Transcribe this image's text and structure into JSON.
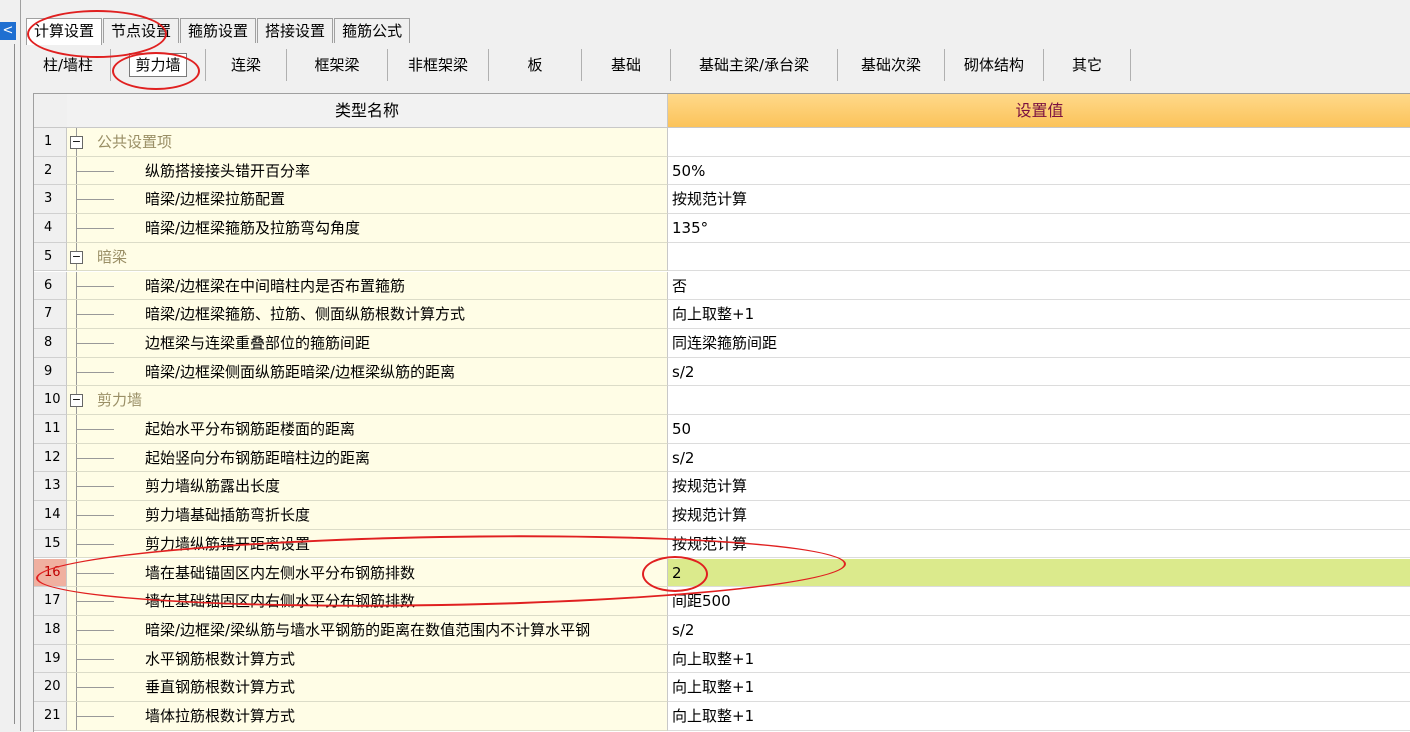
{
  "tabs_primary": [
    "计算设置",
    "节点设置",
    "箍筋设置",
    "搭接设置",
    "箍筋公式"
  ],
  "tabs_primary_active": 0,
  "tabs_secondary": [
    "柱/墙柱",
    "剪力墙",
    "连梁",
    "框架梁",
    "非框架梁",
    "板",
    "基础",
    "基础主梁/承台梁",
    "基础次梁",
    "砌体结构",
    "其它"
  ],
  "tabs_secondary_active": 1,
  "grid": {
    "header_name": "类型名称",
    "header_value": "设置值",
    "rows": [
      {
        "num": "1",
        "name": "公共设置项",
        "value": "",
        "group": true
      },
      {
        "num": "2",
        "name": "纵筋搭接接头错开百分率",
        "value": "50%"
      },
      {
        "num": "3",
        "name": "暗梁/边框梁拉筋配置",
        "value": "按规范计算"
      },
      {
        "num": "4",
        "name": "暗梁/边框梁箍筋及拉筋弯勾角度",
        "value": "135°"
      },
      {
        "num": "5",
        "name": "暗梁",
        "value": "",
        "group": true
      },
      {
        "num": "6",
        "name": "暗梁/边框梁在中间暗柱内是否布置箍筋",
        "value": "否"
      },
      {
        "num": "7",
        "name": "暗梁/边框梁箍筋、拉筋、侧面纵筋根数计算方式",
        "value": "向上取整+1"
      },
      {
        "num": "8",
        "name": "边框梁与连梁重叠部位的箍筋间距",
        "value": "同连梁箍筋间距"
      },
      {
        "num": "9",
        "name": "暗梁/边框梁侧面纵筋距暗梁/边框梁纵筋的距离",
        "value": "s/2"
      },
      {
        "num": "10",
        "name": "剪力墙",
        "value": "",
        "group": true
      },
      {
        "num": "11",
        "name": "起始水平分布钢筋距楼面的距离",
        "value": "50"
      },
      {
        "num": "12",
        "name": "起始竖向分布钢筋距暗柱边的距离",
        "value": "s/2"
      },
      {
        "num": "13",
        "name": "剪力墙纵筋露出长度",
        "value": "按规范计算"
      },
      {
        "num": "14",
        "name": "剪力墙基础插筋弯折长度",
        "value": "按规范计算"
      },
      {
        "num": "15",
        "name": "剪力墙纵筋错开距离设置",
        "value": "按规范计算"
      },
      {
        "num": "16",
        "name": "墙在基础锚固区内左侧水平分布钢筋排数",
        "value": "2",
        "selected": true
      },
      {
        "num": "17",
        "name": "墙在基础锚固区内右侧水平分布钢筋排数",
        "value": "间距500"
      },
      {
        "num": "18",
        "name": "暗梁/边框梁/梁纵筋与墙水平钢筋的距离在数值范围内不计算水平钢",
        "value": "s/2"
      },
      {
        "num": "19",
        "name": "水平钢筋根数计算方式",
        "value": "向上取整+1"
      },
      {
        "num": "20",
        "name": "垂直钢筋根数计算方式",
        "value": "向上取整+1"
      },
      {
        "num": "21",
        "name": "墙体拉筋根数计算方式",
        "value": "向上取整+1"
      }
    ]
  },
  "colors": {
    "header_value_bg": "#fbc35a",
    "selected_value_bg": "#dbea8c",
    "annotation": "#e02020"
  }
}
